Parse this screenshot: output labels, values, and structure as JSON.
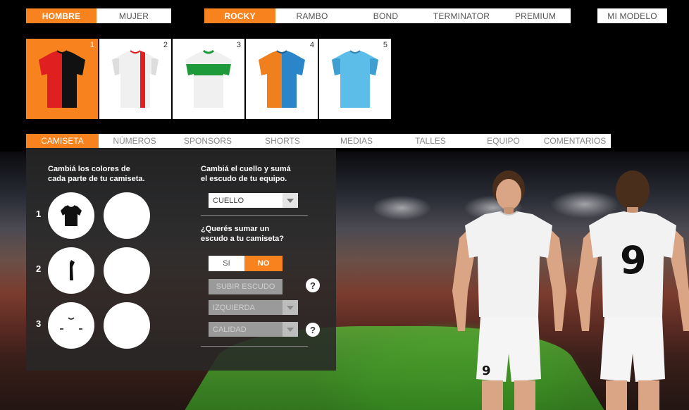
{
  "gender_tabs": [
    {
      "label": "HOMBRE",
      "active": true
    },
    {
      "label": "MUJER",
      "active": false
    }
  ],
  "model_tabs": [
    {
      "label": "ROCKY",
      "active": true
    },
    {
      "label": "RAMBO",
      "active": false
    },
    {
      "label": "BOND",
      "active": false
    },
    {
      "label": "TERMINATOR",
      "active": false
    },
    {
      "label": "PREMIUM",
      "active": false
    }
  ],
  "my_model_label": "MI MODELO",
  "designs": [
    {
      "num": "1",
      "left": "#e02020",
      "right": "#111111",
      "active": true
    },
    {
      "num": "2",
      "left": "#f2f2f2",
      "right": "#f2f2f2",
      "stripe": "#e02020",
      "active": false
    },
    {
      "num": "3",
      "left": "#f2f2f2",
      "right": "#f2f2f2",
      "band": "#1f9a3a",
      "active": false
    },
    {
      "num": "4",
      "left": "#f07f1e",
      "right": "#2a86c8",
      "active": false
    },
    {
      "num": "5",
      "left": "#5bbde8",
      "right": "#5bbde8",
      "active": false
    }
  ],
  "section_tabs": [
    {
      "label": "CAMISETA",
      "active": true
    },
    {
      "label": "NÚMEROS",
      "active": false
    },
    {
      "label": "SPONSORS",
      "active": false
    },
    {
      "label": "SHORTS",
      "active": false
    },
    {
      "label": "MEDIAS",
      "active": false
    },
    {
      "label": "TALLES",
      "active": false
    },
    {
      "label": "EQUIPO",
      "active": false
    },
    {
      "label": "COMENTARIOS",
      "active": false
    }
  ],
  "panel": {
    "colors_text_1": "Cambiá los colores de",
    "colors_text_2": "cada parte de tu camiseta.",
    "collar_text_1": "Cambiá el cuello y sumá",
    "collar_text_2": "el escudo de tu equipo.",
    "collar_select": "CUELLO",
    "crest_question_1": "¿Querés sumar un",
    "crest_question_2": "escudo a tu camiseta?",
    "yes_label": "SI",
    "no_label": "NO",
    "upload_label": "SUBIR ESCUDO",
    "side_select": "IZQUIERDA",
    "quality_select": "CALIDAD",
    "help_symbol": "?",
    "rows": [
      "1",
      "2",
      "3"
    ]
  },
  "players": {
    "back_number": "9",
    "shorts_number": "9"
  },
  "colors": {
    "accent": "#f7821e"
  }
}
